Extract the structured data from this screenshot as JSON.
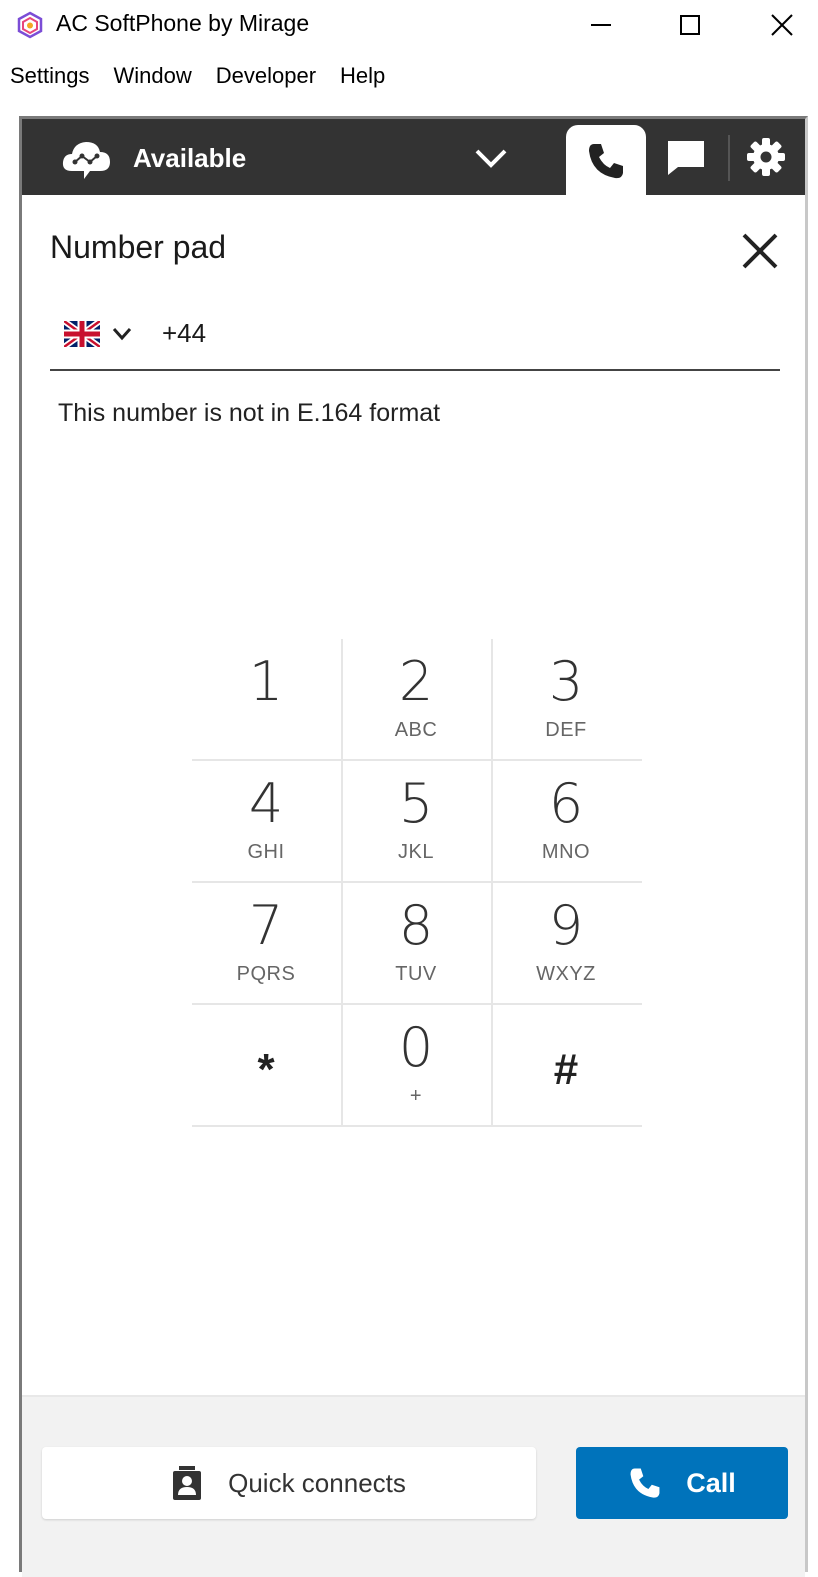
{
  "window": {
    "title": "AC SoftPhone by Mirage",
    "controls": [
      "minimize-icon",
      "maximize-icon",
      "close-icon"
    ]
  },
  "menubar": {
    "items": [
      "Settings",
      "Window",
      "Developer",
      "Help"
    ]
  },
  "topbar": {
    "status": "Available",
    "tabs": [
      "phone-icon",
      "chat-icon",
      "gear-icon"
    ],
    "active_tab": "phone-icon",
    "colors": {
      "bar": "#333333",
      "text": "#ffffff"
    }
  },
  "panel": {
    "title": "Number pad",
    "country_flag": "uk-flag-icon",
    "phone_value": "+44",
    "error": "This number is not in E.164 format"
  },
  "keypad": {
    "keys": [
      {
        "digit": "1",
        "letters": ""
      },
      {
        "digit": "2",
        "letters": "ABC"
      },
      {
        "digit": "3",
        "letters": "DEF"
      },
      {
        "digit": "4",
        "letters": "GHI"
      },
      {
        "digit": "5",
        "letters": "JKL"
      },
      {
        "digit": "6",
        "letters": "MNO"
      },
      {
        "digit": "7",
        "letters": "PQRS"
      },
      {
        "digit": "8",
        "letters": "TUV"
      },
      {
        "digit": "9",
        "letters": "WXYZ"
      },
      {
        "digit": "*",
        "letters": ""
      },
      {
        "digit": "0",
        "letters": "+"
      },
      {
        "digit": "#",
        "letters": ""
      }
    ]
  },
  "footer": {
    "quick_connects": "Quick connects",
    "call": "Call",
    "colors": {
      "call": "#0073bb"
    }
  }
}
